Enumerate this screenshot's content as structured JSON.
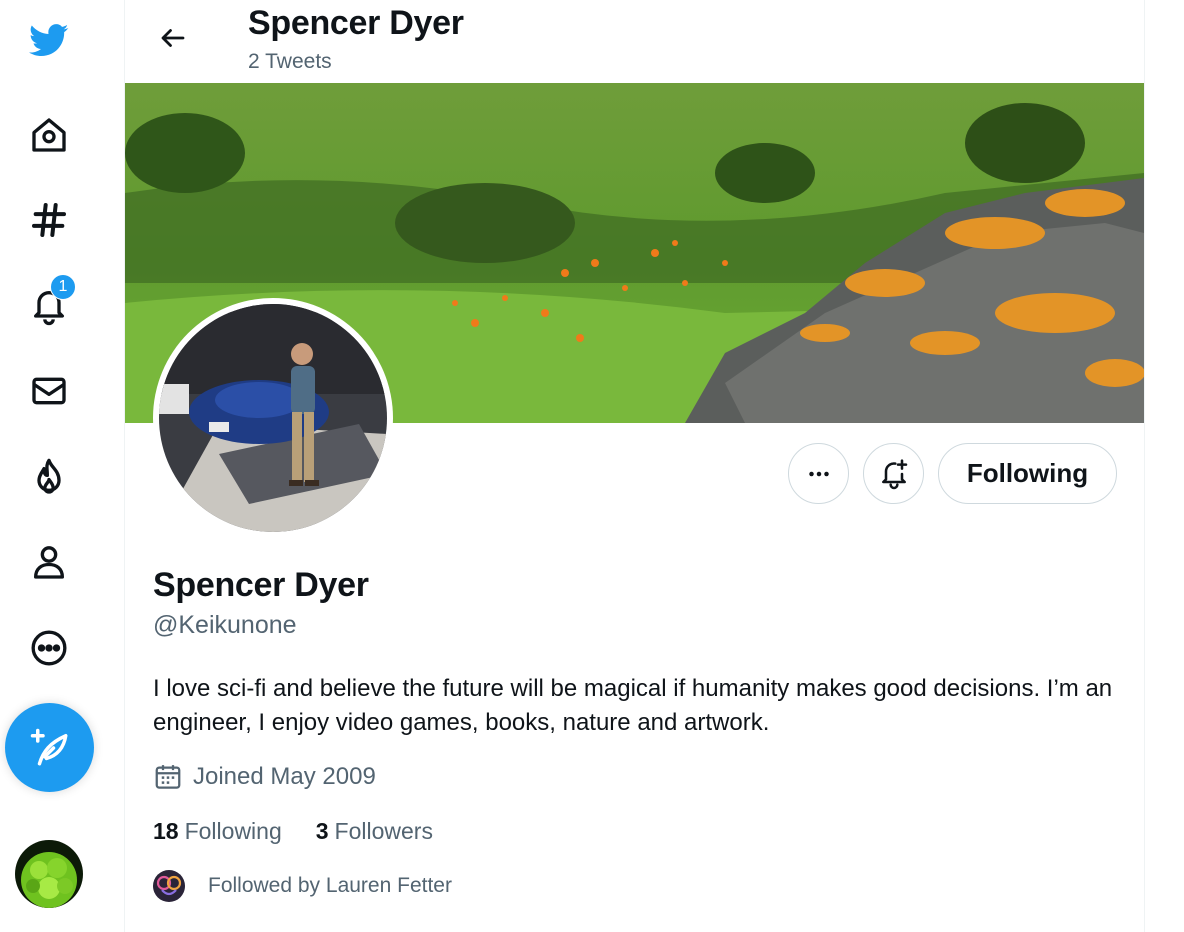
{
  "header": {
    "name": "Spencer Dyer",
    "tweet_count": "2 Tweets"
  },
  "sidebar": {
    "items": [
      {
        "icon": "twitter-logo-icon"
      },
      {
        "icon": "home-icon"
      },
      {
        "icon": "hashtag-icon"
      },
      {
        "icon": "bell-icon"
      },
      {
        "icon": "mail-icon"
      },
      {
        "icon": "flame-icon"
      },
      {
        "icon": "person-icon"
      },
      {
        "icon": "more-circle-icon"
      }
    ],
    "notification_count": "1",
    "compose_icon": "feather-plus-icon"
  },
  "profile": {
    "display_name": "Spencer Dyer",
    "handle": "@Keikunone",
    "bio": "I love sci-fi and believe the future will be magical if humanity makes good decisions. I’m an engineer, I enjoy video games, books, nature and artwork.",
    "joined": "Joined May 2009",
    "following_count": "18",
    "following_label": "Following",
    "followers_count": "3",
    "followers_label": "Followers",
    "followed_by": "Followed by Lauren Fetter"
  },
  "actions": {
    "following_button": "Following"
  },
  "colors": {
    "accent": "#1d9bf0",
    "text": "#0f1419",
    "secondary": "#536471"
  }
}
